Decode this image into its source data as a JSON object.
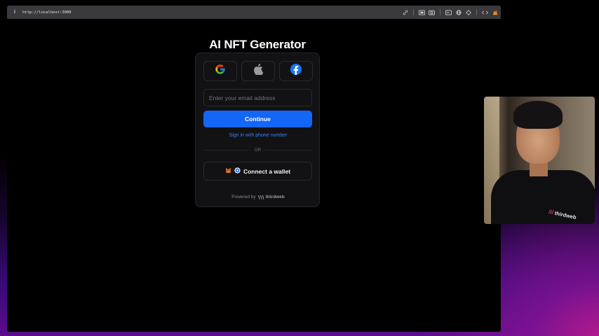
{
  "browser": {
    "url": "http://localhost:3000",
    "toolbar_icons": [
      "link-icon",
      "screenshot-icon",
      "camera-icon",
      "sidebar-icon",
      "globe-icon",
      "crosshair-icon",
      "code-icon",
      "extension-icon"
    ]
  },
  "page": {
    "title": "AI NFT Generator"
  },
  "login": {
    "social": [
      {
        "name": "Google",
        "icon": "google-icon"
      },
      {
        "name": "Apple",
        "icon": "apple-icon"
      },
      {
        "name": "Facebook",
        "icon": "facebook-icon"
      }
    ],
    "email_placeholder": "Enter your email address",
    "continue_label": "Continue",
    "phone_link": "Sign in with phone number",
    "divider_text": "OR",
    "wallet_label": "Connect a wallet",
    "powered_by": "Powered by",
    "brand": "thirdweb"
  },
  "webcam": {
    "shirt_logo": "thirdweb"
  },
  "colors": {
    "accent": "#1466f5",
    "link": "#3b82f6",
    "card_bg": "#121214"
  }
}
